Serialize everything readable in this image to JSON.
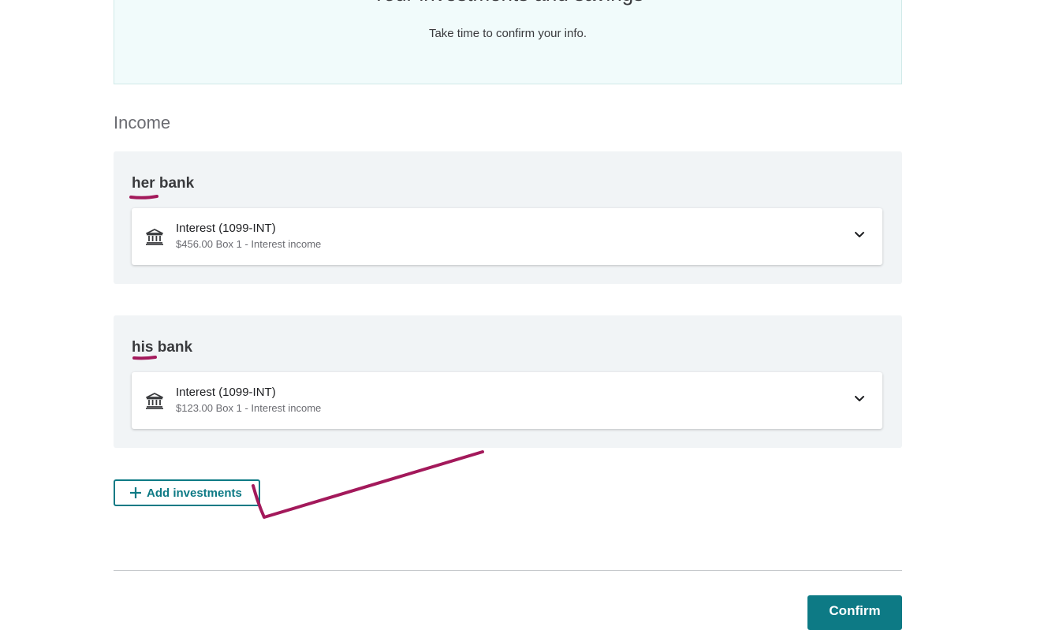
{
  "header": {
    "title": "Your investments and savings",
    "subtitle": "Take time to confirm your info."
  },
  "income": {
    "section_title": "Income",
    "banks": [
      {
        "name": "her bank",
        "form": {
          "icon": "bank-icon",
          "title": "Interest (1099-INT)",
          "detail": "$456.00 Box 1 - Interest income"
        }
      },
      {
        "name": "his bank",
        "form": {
          "icon": "bank-icon",
          "title": "Interest (1099-INT)",
          "detail": "$123.00 Box 1 - Interest income"
        }
      }
    ]
  },
  "actions": {
    "add_investments_label": "Add investments",
    "confirm_label": "Confirm"
  },
  "colors": {
    "accent": "#0d7a85",
    "annotation": "#a3195b",
    "panel_bg": "#f1f4f6",
    "header_bg": "#f1fbfb"
  }
}
